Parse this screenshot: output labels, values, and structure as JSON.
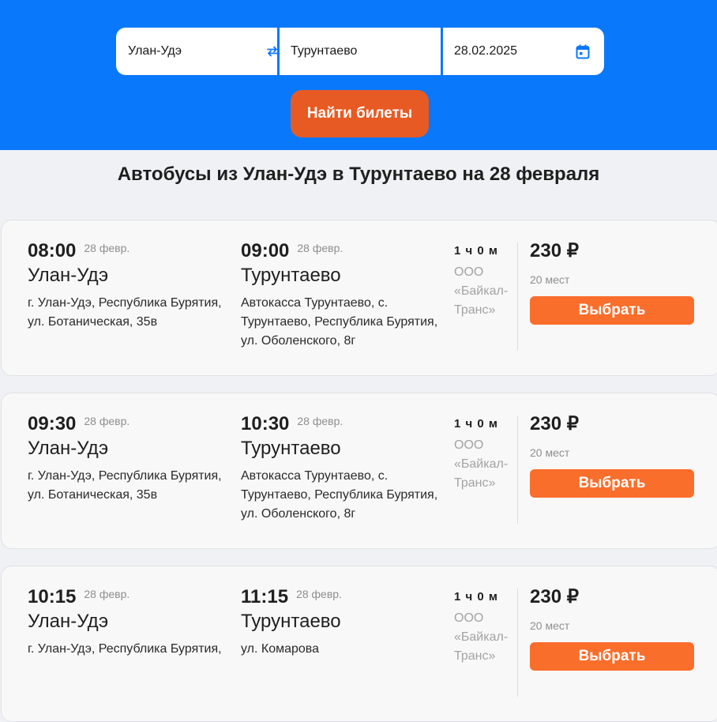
{
  "search": {
    "from": "Улан-Удэ",
    "to": "Турунтаево",
    "date": "28.02.2025",
    "button_label": "Найти билеты"
  },
  "page_title": "Автобусы из Улан-Удэ в Турунтаево на 28 февраля",
  "trips": [
    {
      "dep_time": "08:00",
      "dep_date": "28 февр.",
      "dep_city": "Улан-Удэ",
      "dep_addr": "г. Улан-Удэ, Республика Бурятия, ул. Ботаническая, 35в",
      "arr_time": "09:00",
      "arr_date": "28 февр.",
      "arr_city": "Турунтаево",
      "arr_addr": "Автокасса Турунтаево, с. Турунтаево, Республика Бурятия, ул. Оболенского, 8г",
      "duration": "1 ч 0 м",
      "carrier": "ООО «Байкал-Транс»",
      "price": "230 ₽",
      "seats": "20 мест",
      "button_label": "Выбрать"
    },
    {
      "dep_time": "09:30",
      "dep_date": "28 февр.",
      "dep_city": "Улан-Удэ",
      "dep_addr": "г. Улан-Удэ, Республика Бурятия, ул. Ботаническая, 35в",
      "arr_time": "10:30",
      "arr_date": "28 февр.",
      "arr_city": "Турунтаево",
      "arr_addr": "Автокасса Турунтаево, с. Турунтаево, Республика Бурятия, ул. Оболенского, 8г",
      "duration": "1 ч 0 м",
      "carrier": "ООО «Байкал-Транс»",
      "price": "230 ₽",
      "seats": "20 мест",
      "button_label": "Выбрать"
    },
    {
      "dep_time": "10:15",
      "dep_date": "28 февр.",
      "dep_city": "Улан-Удэ",
      "dep_addr": "г. Улан-Удэ, Республика Бурятия,",
      "arr_time": "11:15",
      "arr_date": "28 февр.",
      "arr_city": "Турунтаево",
      "arr_addr": "ул. Комарова",
      "duration": "1 ч 0 м",
      "carrier": "ООО «Байкал-Транс»",
      "price": "230 ₽",
      "seats": "20 мест",
      "button_label": "Выбрать"
    }
  ]
}
